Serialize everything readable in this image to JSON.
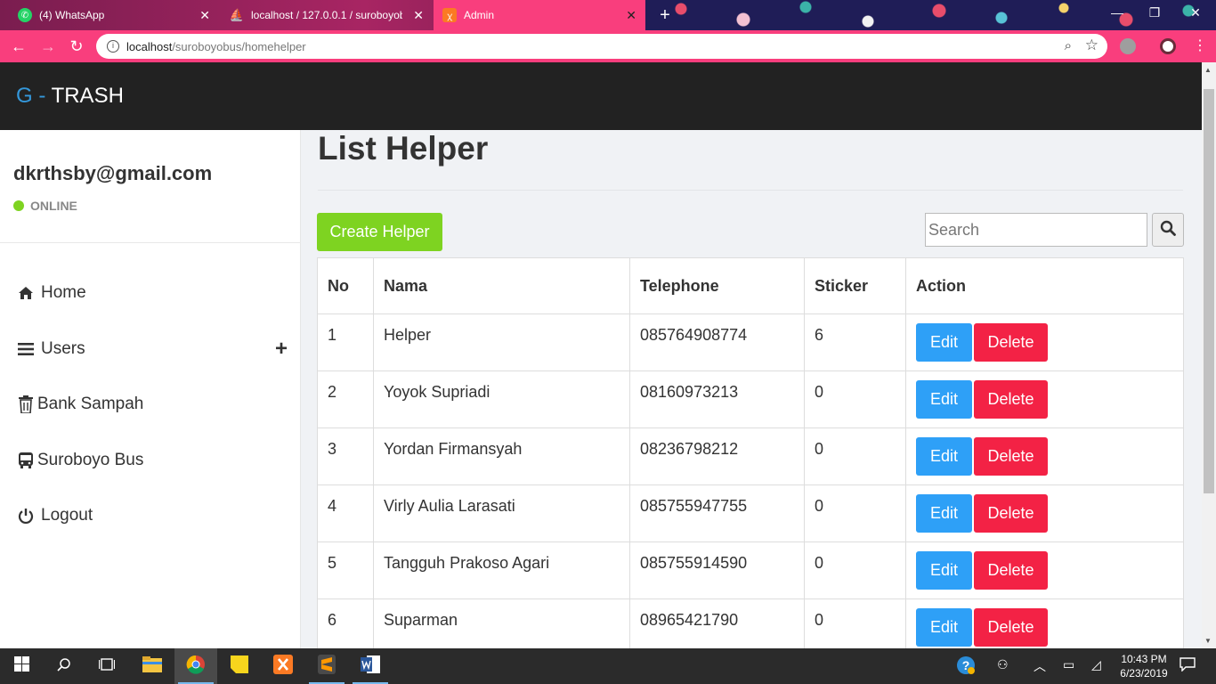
{
  "browser": {
    "tabs": [
      {
        "label": "(4) WhatsApp",
        "icon": "whatsapp-icon"
      },
      {
        "label": "localhost / 127.0.0.1 / suroboyob",
        "icon": "phpmyadmin-icon"
      },
      {
        "label": "Admin",
        "icon": "xampp-icon"
      }
    ],
    "active_tab": 2,
    "url_host": "localhost",
    "url_path": "/suroboyobus/homehelper"
  },
  "app": {
    "brand_prefix": "G -",
    "brand_name": " TRASH"
  },
  "sidebar": {
    "email": "dkrthsby@gmail.com",
    "status": "ONLINE",
    "items": [
      {
        "label": "Home",
        "icon": "home-icon"
      },
      {
        "label": "Users",
        "icon": "list-icon"
      },
      {
        "label": "Bank Sampah",
        "icon": "trash-icon"
      },
      {
        "label": "Suroboyo Bus",
        "icon": "bus-icon"
      },
      {
        "label": "Logout",
        "icon": "power-icon"
      }
    ]
  },
  "main": {
    "title": "List Helper",
    "create_label": "Create Helper",
    "search_placeholder": "Search",
    "columns": [
      "No",
      "Nama",
      "Telephone",
      "Sticker",
      "Action"
    ],
    "edit_label": "Edit",
    "delete_label": "Delete",
    "rows": [
      {
        "no": "1",
        "nama": "Helper",
        "telephone": "085764908774",
        "sticker": "6"
      },
      {
        "no": "2",
        "nama": "Yoyok Supriadi",
        "telephone": "08160973213",
        "sticker": "0"
      },
      {
        "no": "3",
        "nama": "Yordan Firmansyah",
        "telephone": "08236798212",
        "sticker": "0"
      },
      {
        "no": "4",
        "nama": "Virly Aulia Larasati",
        "telephone": "085755947755",
        "sticker": "0"
      },
      {
        "no": "5",
        "nama": "Tangguh Prakoso Agari",
        "telephone": "085755914590",
        "sticker": "0"
      },
      {
        "no": "6",
        "nama": "Suparman",
        "telephone": "08965421790",
        "sticker": "0"
      }
    ]
  },
  "taskbar": {
    "time": "10:43 PM",
    "date": "6/23/2019"
  },
  "colors": {
    "accent_browser": "#f93e7d",
    "create_button": "#7ed321",
    "edit_button": "#2ea0f7",
    "delete_button": "#f32245",
    "online_dot": "#7ed321",
    "header": "#222222",
    "brand_g": "#3498db"
  }
}
